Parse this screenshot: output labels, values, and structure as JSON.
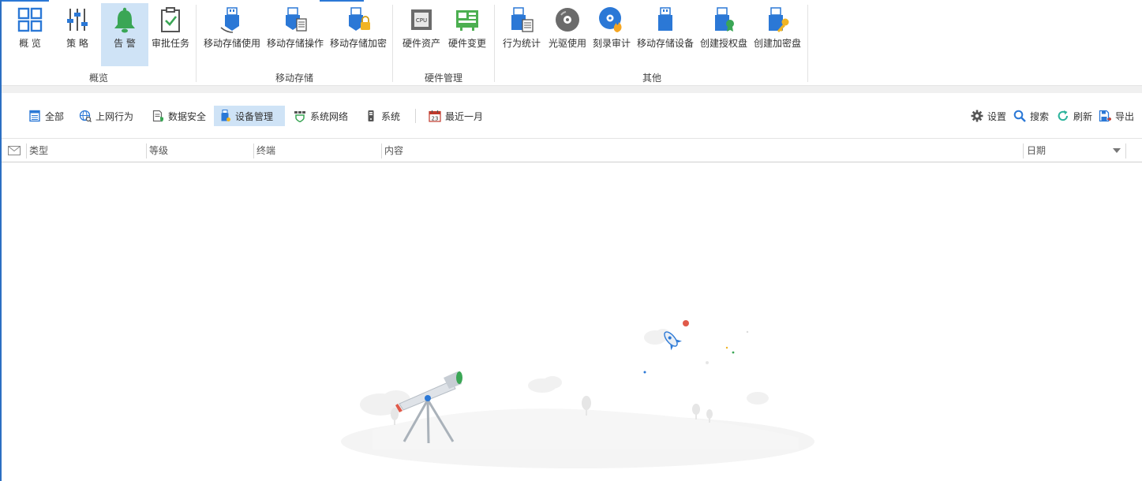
{
  "ribbon": {
    "groups": [
      {
        "label": "概览",
        "buttons": [
          {
            "label": "概 览",
            "icon": "grid-icon"
          },
          {
            "label": "策 略",
            "icon": "sliders-icon"
          },
          {
            "label": "告 警",
            "icon": "bell-icon",
            "active": true
          },
          {
            "label": "审批任务",
            "icon": "clipboard-check-icon"
          }
        ]
      },
      {
        "label": "移动存储",
        "buttons": [
          {
            "label": "移动存储使用",
            "icon": "usb-icon"
          },
          {
            "label": "移动存储操作",
            "icon": "usb-doc-icon"
          },
          {
            "label": "移动存储加密",
            "icon": "usb-lock-icon"
          }
        ]
      },
      {
        "label": "硬件管理",
        "buttons": [
          {
            "label": "硬件资产",
            "icon": "cpu-icon"
          },
          {
            "label": "硬件变更",
            "icon": "board-icon"
          }
        ]
      },
      {
        "label": "其他",
        "buttons": [
          {
            "label": "行为统计",
            "icon": "usb-stats-icon"
          },
          {
            "label": "光驱使用",
            "icon": "disc-icon"
          },
          {
            "label": "刻录审计",
            "icon": "disc-burn-icon"
          },
          {
            "label": "移动存储设备",
            "icon": "usb-device-icon"
          },
          {
            "label": "创建授权盘",
            "icon": "usb-auth-icon"
          },
          {
            "label": "创建加密盘",
            "icon": "usb-key-icon"
          }
        ]
      }
    ]
  },
  "filters": {
    "all": "全部",
    "web": "上网行为",
    "data_security": "数据安全",
    "device_mgmt": "设备管理",
    "sys_network": "系统网络",
    "system": "系统",
    "date_range": "最近一月",
    "date_icon_text": "23",
    "settings": "设置",
    "search": "搜索",
    "refresh": "刷新",
    "export": "导出"
  },
  "table": {
    "columns": [
      "类型",
      "等级",
      "终端",
      "内容",
      "日期"
    ]
  },
  "colors": {
    "accent": "#2b78d6",
    "active_bg": "#cfe3f6",
    "bell_green": "#3aa655"
  }
}
